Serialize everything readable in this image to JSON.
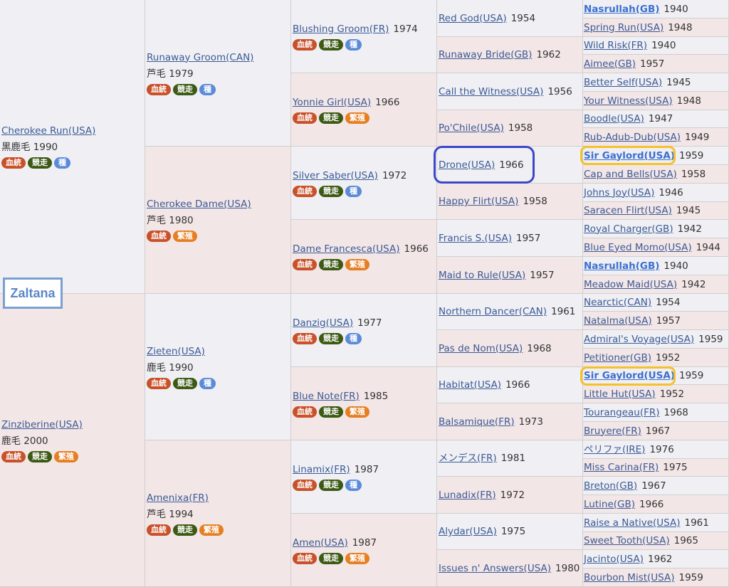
{
  "badges": {
    "ketto": "血統",
    "kyoso": "競走",
    "shu": "種",
    "hanshoku": "繁殖"
  },
  "overlay": {
    "label": "Zaltana"
  },
  "pedigree": {
    "g1": [
      {
        "name": "Cherokee Run(USA)",
        "sub": "黒鹿毛 1990",
        "badges": [
          "ketto",
          "kyoso",
          "shu"
        ]
      },
      {
        "name": "Zinziberine(USA)",
        "sub": "鹿毛 2000",
        "badges": [
          "ketto",
          "kyoso",
          "hanshoku"
        ]
      }
    ],
    "g2": [
      {
        "name": "Runaway Groom(CAN)",
        "sub": "芦毛 1979",
        "badges": [
          "ketto",
          "kyoso",
          "shu"
        ]
      },
      {
        "name": "Cherokee Dame(USA)",
        "sub": "芦毛 1980",
        "badges": [
          "ketto",
          "hanshoku"
        ]
      },
      {
        "name": "Zieten(USA)",
        "sub": "鹿毛 1990",
        "badges": [
          "ketto",
          "kyoso",
          "shu"
        ]
      },
      {
        "name": "Amenixa(FR)",
        "sub": "芦毛 1994",
        "badges": [
          "ketto",
          "kyoso",
          "hanshoku"
        ]
      }
    ],
    "g3": [
      {
        "name": "Blushing Groom(FR)",
        "year": "1974",
        "badges": [
          "ketto",
          "kyoso",
          "shu"
        ]
      },
      {
        "name": "Yonnie Girl(USA)",
        "year": "1966",
        "badges": [
          "ketto",
          "kyoso",
          "hanshoku"
        ]
      },
      {
        "name": "Silver Saber(USA)",
        "year": "1972",
        "badges": [
          "ketto",
          "kyoso",
          "shu"
        ]
      },
      {
        "name": "Dame Francesca(USA)",
        "year": "1966",
        "badges": [
          "ketto",
          "kyoso",
          "hanshoku"
        ]
      },
      {
        "name": "Danzig(USA)",
        "year": "1977",
        "badges": [
          "ketto",
          "kyoso",
          "shu"
        ]
      },
      {
        "name": "Blue Note(FR)",
        "year": "1985",
        "badges": [
          "ketto",
          "kyoso",
          "hanshoku"
        ]
      },
      {
        "name": "Linamix(FR)",
        "year": "1987",
        "badges": [
          "ketto",
          "kyoso",
          "shu"
        ]
      },
      {
        "name": "Amen(USA)",
        "year": "1987",
        "badges": [
          "ketto",
          "kyoso",
          "hanshoku"
        ]
      }
    ],
    "g4": [
      {
        "name": "Red God(USA)",
        "year": "1954"
      },
      {
        "name": "Runaway Bride(GB)",
        "year": "1962"
      },
      {
        "name": "Call the Witness(USA)",
        "year": "1956"
      },
      {
        "name": "Po'Chile(USA)",
        "year": "1958"
      },
      {
        "name": "Drone(USA)",
        "year": "1966"
      },
      {
        "name": "Happy Flirt(USA)",
        "year": "1958"
      },
      {
        "name": "Francis S.(USA)",
        "year": "1957"
      },
      {
        "name": "Maid to Rule(USA)",
        "year": "1957"
      },
      {
        "name": "Northern Dancer(CAN)",
        "year": "1961"
      },
      {
        "name": "Pas de Nom(USA)",
        "year": "1968"
      },
      {
        "name": "Habitat(USA)",
        "year": "1966"
      },
      {
        "name": "Balsamique(FR)",
        "year": "1973"
      },
      {
        "name": "メンデス(FR)",
        "year": "1981"
      },
      {
        "name": "Lunadix(FR)",
        "year": "1972"
      },
      {
        "name": "Alydar(USA)",
        "year": "1975"
      },
      {
        "name": "Issues n' Answers(USA)",
        "year": "1980"
      }
    ],
    "g5": [
      {
        "name": "Nasrullah(GB)",
        "year": "1940",
        "bold": true
      },
      {
        "name": "Spring Run(USA)",
        "year": "1948"
      },
      {
        "name": "Wild Risk(FR)",
        "year": "1940"
      },
      {
        "name": "Aimee(GB)",
        "year": "1957"
      },
      {
        "name": "Better Self(USA)",
        "year": "1945"
      },
      {
        "name": "Your Witness(USA)",
        "year": "1948"
      },
      {
        "name": "Boodle(USA)",
        "year": "1947"
      },
      {
        "name": "Rub-Adub-Dub(USA)",
        "year": "1949"
      },
      {
        "name": "Sir Gaylord(USA)",
        "year": "1959",
        "bold": true
      },
      {
        "name": "Cap and Bells(USA)",
        "year": "1958"
      },
      {
        "name": "Johns Joy(USA)",
        "year": "1946"
      },
      {
        "name": "Saracen Flirt(USA)",
        "year": "1945"
      },
      {
        "name": "Royal Charger(GB)",
        "year": "1942"
      },
      {
        "name": "Blue Eyed Momo(USA)",
        "year": "1944"
      },
      {
        "name": "Nasrullah(GB)",
        "year": "1940",
        "bold": true
      },
      {
        "name": "Meadow Maid(USA)",
        "year": "1942"
      },
      {
        "name": "Nearctic(CAN)",
        "year": "1954"
      },
      {
        "name": "Natalma(USA)",
        "year": "1957"
      },
      {
        "name": "Admiral's Voyage(USA)",
        "year": "1959"
      },
      {
        "name": "Petitioner(GB)",
        "year": "1952"
      },
      {
        "name": "Sir Gaylord(USA)",
        "year": "1959",
        "bold": true
      },
      {
        "name": "Little Hut(USA)",
        "year": "1952"
      },
      {
        "name": "Tourangeau(FR)",
        "year": "1968"
      },
      {
        "name": "Bruyere(FR)",
        "year": "1967"
      },
      {
        "name": "ペリファ(IRE)",
        "year": "1976"
      },
      {
        "name": "Miss Carina(FR)",
        "year": "1975"
      },
      {
        "name": "Breton(GB)",
        "year": "1967"
      },
      {
        "name": "Lutine(GB)",
        "year": "1966"
      },
      {
        "name": "Raise a Native(USA)",
        "year": "1961"
      },
      {
        "name": "Sweet Tooth(USA)",
        "year": "1965"
      },
      {
        "name": "Jacinto(USA)",
        "year": "1962"
      },
      {
        "name": "Bourbon Mist(USA)",
        "year": "1959"
      }
    ]
  }
}
